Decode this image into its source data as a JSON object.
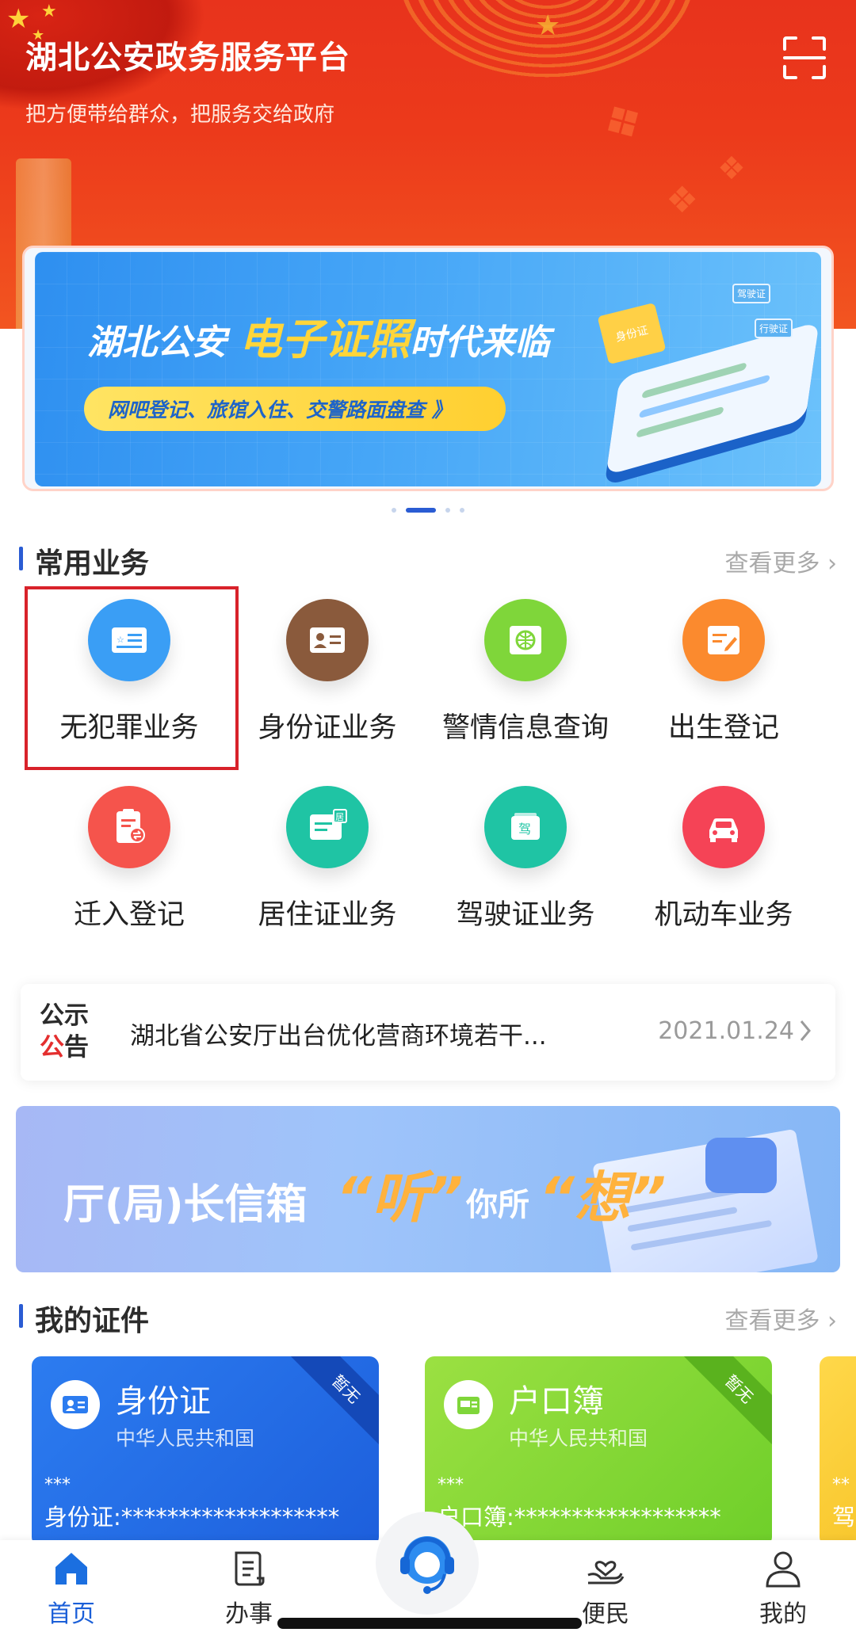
{
  "header": {
    "title": "湖北公安政务服务平台",
    "subtitle": "把方便带给群众，把服务交给政府",
    "scan_icon": "scan-icon"
  },
  "banner": {
    "headline_prefix": "湖北公安",
    "headline_highlight": "电子证照",
    "headline_suffix": "时代来临",
    "pill_text": "网吧登记、旅馆入住、交警路面盘查 》",
    "card_id": "身份证",
    "card_drive": "行驶证",
    "card_reg": "驾驶证",
    "page_count": 4,
    "active_page": 1
  },
  "services": {
    "title": "常用业务",
    "more": "查看更多 ›",
    "items": [
      {
        "label": "无犯罪业务",
        "icon": "id-card-icon",
        "color": "#3a9ef5"
      },
      {
        "label": "身份证业务",
        "icon": "person-card-icon",
        "color": "#8a5a3c"
      },
      {
        "label": "警情信息查询",
        "icon": "globe-icon",
        "color": "#7fd63a"
      },
      {
        "label": "出生登记",
        "icon": "form-pen-icon",
        "color": "#fb8a2e"
      },
      {
        "label": "迁入登记",
        "icon": "transfer-doc-icon",
        "color": "#f5544c"
      },
      {
        "label": "居住证业务",
        "icon": "residence-card-icon",
        "color": "#1fc4a4"
      },
      {
        "label": "驾驶证业务",
        "icon": "driver-license-icon",
        "color": "#1fc4a4"
      },
      {
        "label": "机动车业务",
        "icon": "car-icon",
        "color": "#f54356"
      }
    ],
    "residence_badge": "居",
    "driver_badge": "驾"
  },
  "notice": {
    "tag_line1": "公示",
    "tag_line2_red": "公",
    "tag_line2_dark": "告",
    "text": "湖北省公安厅出台优化营商环境若干...",
    "date": "2021.01.24"
  },
  "mailbox": {
    "title": "厅(局)长信箱",
    "quote1": "“听”",
    "middle": "你所",
    "quote2": "“想”"
  },
  "certificates": {
    "title": "我的证件",
    "more": "查看更多 ›",
    "items": [
      {
        "name": "身份证",
        "country": "中华人民共和国",
        "stars": "***",
        "number": "身份证:*******************",
        "ribbon": "暂无",
        "icon": "id-card-icon"
      },
      {
        "name": "户口簿",
        "country": "中华人民共和国",
        "stars": "***",
        "number": "户口簿:******************",
        "ribbon": "暂无",
        "icon": "household-book-icon"
      },
      {
        "stars": "**",
        "number": "驾"
      }
    ]
  },
  "tabbar": {
    "items": [
      {
        "label": "首页",
        "icon": "home-icon",
        "active": true
      },
      {
        "label": "办事",
        "icon": "document-icon",
        "active": false
      },
      {
        "label": "便民",
        "icon": "hand-heart-icon",
        "active": false
      },
      {
        "label": "我的",
        "icon": "user-icon",
        "active": false
      }
    ],
    "center_icon": "customer-service-icon"
  },
  "colors": {
    "brand_blue": "#2a5cd3",
    "header_red": "#e8331c",
    "highlight_red": "#d8222a"
  }
}
